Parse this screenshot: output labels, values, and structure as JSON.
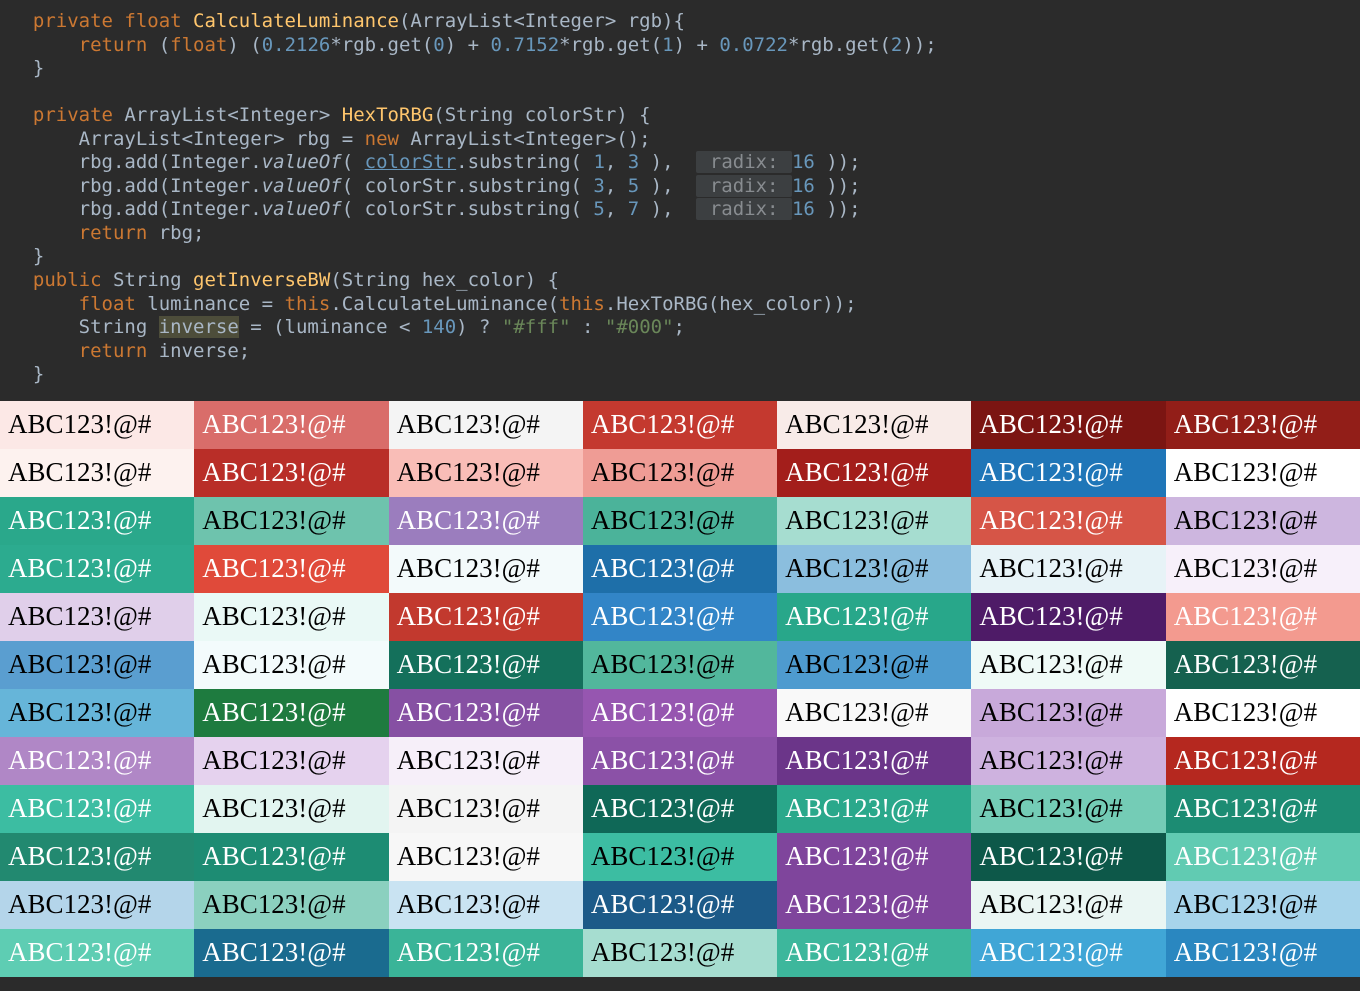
{
  "code": {
    "l1": {
      "a": "private ",
      "b": "float ",
      "c": "CalculateLuminance",
      "d": "(ArrayList<Integer> rgb){"
    },
    "l2": {
      "a": "return ",
      "b": "(",
      "c": "float",
      "d": ") (",
      "e": "0.2126",
      "f": "*rgb.get(",
      "g": "0",
      "h": ") + ",
      "i": "0.7152",
      "j": "*rgb.get(",
      "k": "1",
      "l": ") + ",
      "m": "0.0722",
      "n": "*rgb.get(",
      "o": "2",
      "p": "));"
    },
    "l3": {
      "a": "}"
    },
    "l5": {
      "a": "private ",
      "b": "ArrayList<Integer> ",
      "c": "HexToRBG",
      "d": "(String colorStr) {"
    },
    "l6": {
      "a": "ArrayList<Integer> rbg = ",
      "b": "new ",
      "c": "ArrayList<Integer>();"
    },
    "l7": {
      "a": "rbg.add(Integer.",
      "b": "valueOf",
      "c": "( ",
      "d": "colorStr",
      "e": ".substring( ",
      "f": "1",
      "g": ", ",
      "h": "3",
      "i": " ),  ",
      "j": " radix: ",
      "k": "16 ",
      "l": "));"
    },
    "l8": {
      "a": "rbg.add(Integer.",
      "b": "valueOf",
      "c": "( colorStr.substring( ",
      "f": "3",
      "g": ", ",
      "h": "5",
      "i": " ),  ",
      "j": " radix: ",
      "k": "16 ",
      "l": "));"
    },
    "l9": {
      "a": "rbg.add(Integer.",
      "b": "valueOf",
      "c": "( colorStr.substring( ",
      "f": "5",
      "g": ", ",
      "h": "7",
      "i": " ),  ",
      "j": " radix: ",
      "k": "16 ",
      "l": "));"
    },
    "l10": {
      "a": "return ",
      "b": "rbg;"
    },
    "l11": {
      "a": "}"
    },
    "l12": {
      "a": "public ",
      "b": "String ",
      "c": "getInverseBW",
      "d": "(String hex_color) {"
    },
    "l13": {
      "a": "float ",
      "b": "luminance = ",
      "c": "this",
      "d": ".CalculateLuminance(",
      "e": "this",
      "f": ".HexToRBG(hex_color));"
    },
    "l14": {
      "a": "String ",
      "b": "inverse",
      "c": " = (luminance < ",
      "d": "140",
      "e": ") ? ",
      "f": "\"#fff\" ",
      "g": ": ",
      "h": "\"#000\"",
      "i": ";"
    },
    "l15": {
      "a": "return ",
      "b": "inverse;"
    },
    "l16": {
      "a": "}"
    }
  },
  "sample_text": "ABC123!@#",
  "rows": [
    [
      {
        "bg": "#FCE8E6",
        "fg": "#000"
      },
      {
        "bg": "#D96D6A",
        "fg": "#fff"
      },
      {
        "bg": "#F4F4F4",
        "fg": "#000"
      },
      {
        "bg": "#C4392F",
        "fg": "#fff"
      },
      {
        "bg": "#F8EBE8",
        "fg": "#000"
      },
      {
        "bg": "#7B1512",
        "fg": "#fff"
      },
      {
        "bg": "#921E18",
        "fg": "#fff"
      }
    ],
    [
      {
        "bg": "#FDF2EF",
        "fg": "#000"
      },
      {
        "bg": "#B92E28",
        "fg": "#fff"
      },
      {
        "bg": "#F9BDB7",
        "fg": "#000"
      },
      {
        "bg": "#EF9C95",
        "fg": "#000"
      },
      {
        "bg": "#A31E1B",
        "fg": "#fff"
      },
      {
        "bg": "#1F76B8",
        "fg": "#fff"
      },
      {
        "bg": "#FFFFFF",
        "fg": "#000"
      }
    ],
    [
      {
        "bg": "#2AA88B",
        "fg": "#fff"
      },
      {
        "bg": "#6EC3AD",
        "fg": "#000"
      },
      {
        "bg": "#9B7DBE",
        "fg": "#fff"
      },
      {
        "bg": "#4BB39A",
        "fg": "#000"
      },
      {
        "bg": "#A6DDD0",
        "fg": "#000"
      },
      {
        "bg": "#D65547",
        "fg": "#fff"
      },
      {
        "bg": "#CDB6DF",
        "fg": "#000"
      }
    ],
    [
      {
        "bg": "#2CAB8F",
        "fg": "#fff"
      },
      {
        "bg": "#E04A3A",
        "fg": "#fff"
      },
      {
        "bg": "#F3FAFB",
        "fg": "#000"
      },
      {
        "bg": "#1E6FA9",
        "fg": "#fff"
      },
      {
        "bg": "#8BBEDE",
        "fg": "#000"
      },
      {
        "bg": "#E7F3F7",
        "fg": "#000"
      },
      {
        "bg": "#F7F0FA",
        "fg": "#000"
      }
    ],
    [
      {
        "bg": "#E0CFEA",
        "fg": "#000"
      },
      {
        "bg": "#EAF9F6",
        "fg": "#000"
      },
      {
        "bg": "#C2392E",
        "fg": "#fff"
      },
      {
        "bg": "#3285C7",
        "fg": "#fff"
      },
      {
        "bg": "#28A78A",
        "fg": "#fff"
      },
      {
        "bg": "#4E1B67",
        "fg": "#fff"
      },
      {
        "bg": "#F39A8F",
        "fg": "#fff"
      }
    ],
    [
      {
        "bg": "#5A9ED0",
        "fg": "#000"
      },
      {
        "bg": "#F3FBFC",
        "fg": "#000"
      },
      {
        "bg": "#14705B",
        "fg": "#fff"
      },
      {
        "bg": "#52B79C",
        "fg": "#000"
      },
      {
        "bg": "#4E9BCF",
        "fg": "#000"
      },
      {
        "bg": "#EFFAF7",
        "fg": "#000"
      },
      {
        "bg": "#15614F",
        "fg": "#fff"
      }
    ],
    [
      {
        "bg": "#66B5D9",
        "fg": "#000"
      },
      {
        "bg": "#1E7B3F",
        "fg": "#fff"
      },
      {
        "bg": "#8650A3",
        "fg": "#fff"
      },
      {
        "bg": "#9656B0",
        "fg": "#fff"
      },
      {
        "bg": "#F9F9F9",
        "fg": "#000"
      },
      {
        "bg": "#C8A9DA",
        "fg": "#000"
      },
      {
        "bg": "#FFFFFF",
        "fg": "#000"
      }
    ],
    [
      {
        "bg": "#B087C6",
        "fg": "#fff"
      },
      {
        "bg": "#E5D2EE",
        "fg": "#000"
      },
      {
        "bg": "#F6EFF9",
        "fg": "#000"
      },
      {
        "bg": "#8B51A7",
        "fg": "#fff"
      },
      {
        "bg": "#6B3589",
        "fg": "#fff"
      },
      {
        "bg": "#CEB2DF",
        "fg": "#000"
      },
      {
        "bg": "#B5281F",
        "fg": "#fff"
      }
    ],
    [
      {
        "bg": "#3CBDA2",
        "fg": "#fff"
      },
      {
        "bg": "#E2F5F0",
        "fg": "#000"
      },
      {
        "bg": "#F4F4F4",
        "fg": "#000"
      },
      {
        "bg": "#0F6857",
        "fg": "#fff"
      },
      {
        "bg": "#2AA88B",
        "fg": "#fff"
      },
      {
        "bg": "#74CCB6",
        "fg": "#000"
      },
      {
        "bg": "#1C8C73",
        "fg": "#fff"
      }
    ],
    [
      {
        "bg": "#228970",
        "fg": "#fff"
      },
      {
        "bg": "#1D8C73",
        "fg": "#fff"
      },
      {
        "bg": "#F7F7F7",
        "fg": "#000"
      },
      {
        "bg": "#3CBDA2",
        "fg": "#000"
      },
      {
        "bg": "#7F459C",
        "fg": "#fff"
      },
      {
        "bg": "#0D5849",
        "fg": "#fff"
      },
      {
        "bg": "#61CBB2",
        "fg": "#fff"
      }
    ],
    [
      {
        "bg": "#B4D5EA",
        "fg": "#000"
      },
      {
        "bg": "#8BD0BF",
        "fg": "#000"
      },
      {
        "bg": "#C9E3F2",
        "fg": "#000"
      },
      {
        "bg": "#1C5A88",
        "fg": "#fff"
      },
      {
        "bg": "#7F459C",
        "fg": "#fff"
      },
      {
        "bg": "#EAF6F3",
        "fg": "#000"
      },
      {
        "bg": "#A7D4EB",
        "fg": "#000"
      }
    ],
    [
      {
        "bg": "#5ECDB3",
        "fg": "#fff"
      },
      {
        "bg": "#1A6B8F",
        "fg": "#fff"
      },
      {
        "bg": "#3AB498",
        "fg": "#fff"
      },
      {
        "bg": "#A6DDD0",
        "fg": "#000"
      },
      {
        "bg": "#3DB79C",
        "fg": "#fff"
      },
      {
        "bg": "#40A6D6",
        "fg": "#fff"
      },
      {
        "bg": "#2A87C0",
        "fg": "#fff"
      }
    ]
  ]
}
